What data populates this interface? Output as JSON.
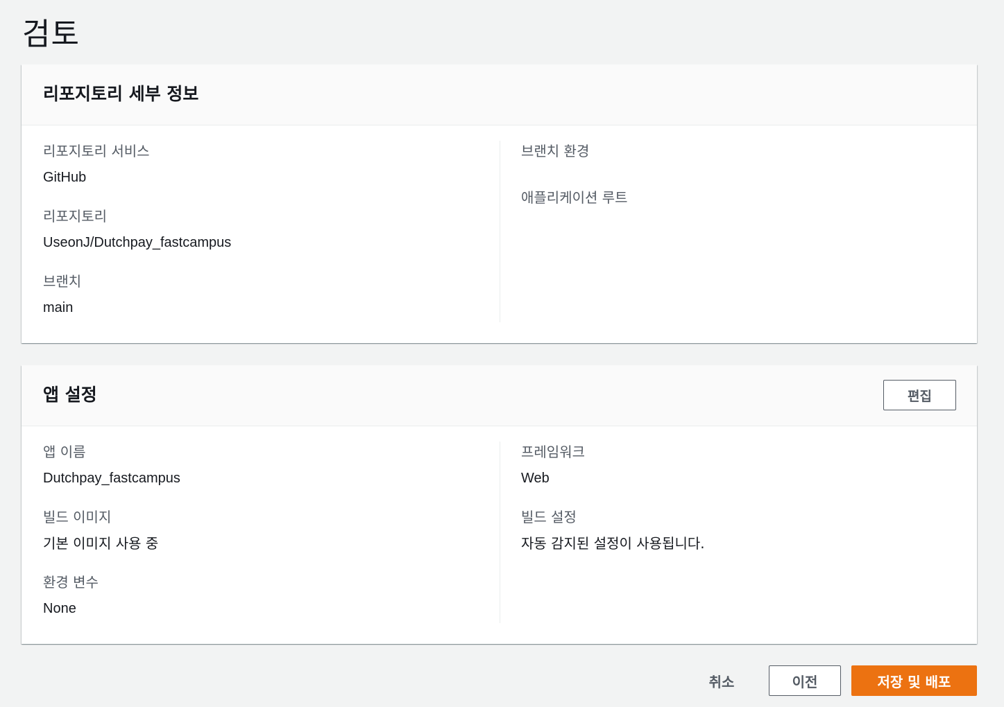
{
  "page": {
    "title": "검토"
  },
  "repo_section": {
    "title": "리포지토리 세부 정보",
    "left": [
      {
        "label": "리포지토리 서비스",
        "value": "GitHub"
      },
      {
        "label": "리포지토리",
        "value": "UseonJ/Dutchpay_fastcampus"
      },
      {
        "label": "브랜치",
        "value": "main"
      }
    ],
    "right": [
      {
        "label": "브랜치 환경",
        "value": ""
      },
      {
        "label": "애플리케이션 루트",
        "value": ""
      }
    ]
  },
  "app_section": {
    "title": "앱 설정",
    "edit_label": "편집",
    "left": [
      {
        "label": "앱 이름",
        "value": "Dutchpay_fastcampus"
      },
      {
        "label": "빌드 이미지",
        "value": "기본 이미지 사용 중"
      },
      {
        "label": "환경 변수",
        "value": "None"
      }
    ],
    "right": [
      {
        "label": "프레임워크",
        "value": "Web"
      },
      {
        "label": "빌드 설정",
        "value": "자동 감지된 설정이 사용됩니다."
      }
    ]
  },
  "footer": {
    "cancel_label": "취소",
    "prev_label": "이전",
    "deploy_label": "저장 및 배포"
  },
  "colors": {
    "background": "#f2f3f3",
    "primary_button": "#ec7211",
    "label_text": "#545b64"
  }
}
